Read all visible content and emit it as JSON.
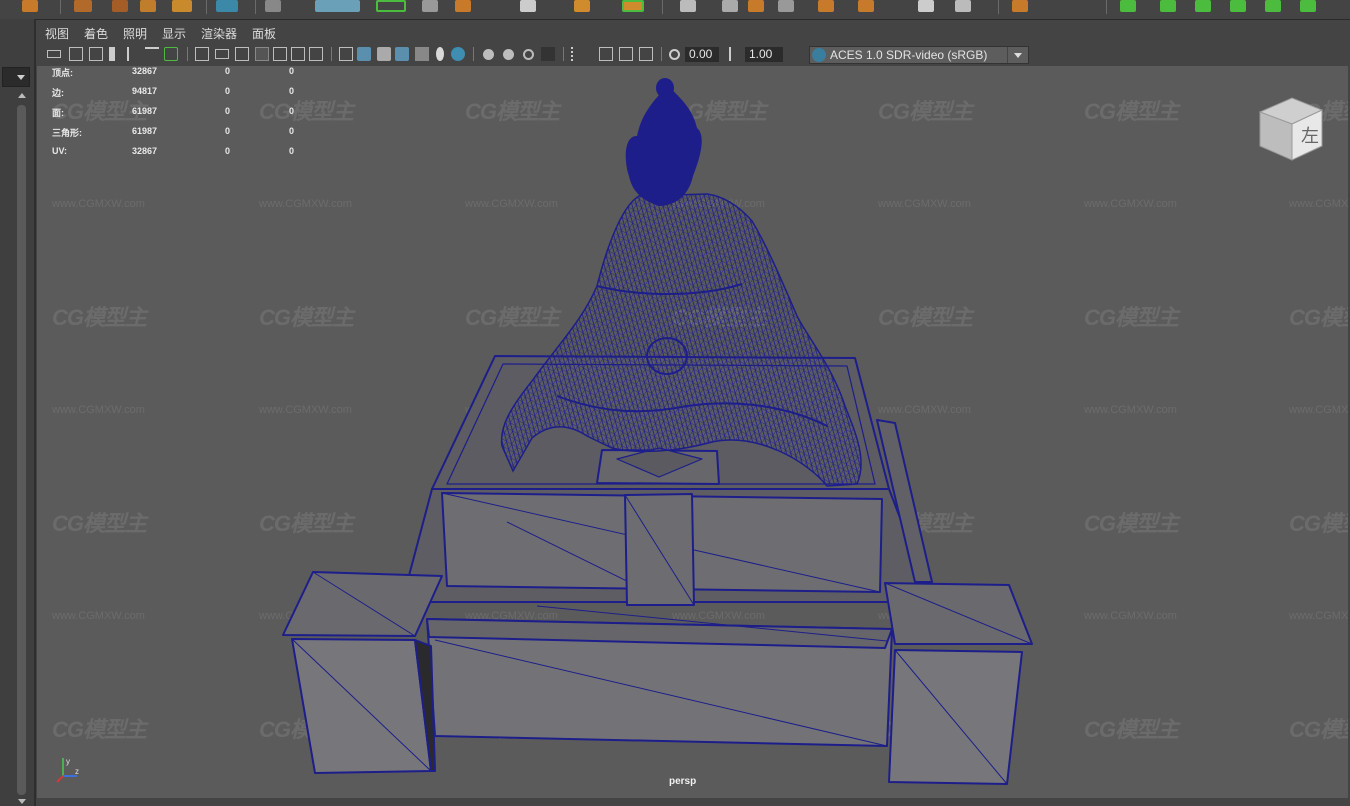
{
  "menu": [
    "视图",
    "着色",
    "照明",
    "显示",
    "渲染器",
    "面板"
  ],
  "toolbar": {
    "exposure_value": "0.00",
    "gamma_value": "1.00",
    "colorspace": "ACES 1.0 SDR-video (sRGB)"
  },
  "hud": [
    {
      "label": "顶点:",
      "v1": "32867",
      "v2": "0",
      "v3": "0"
    },
    {
      "label": "边:",
      "v1": "94817",
      "v2": "0",
      "v3": "0"
    },
    {
      "label": "面:",
      "v1": "61987",
      "v2": "0",
      "v3": "0"
    },
    {
      "label": "三角形:",
      "v1": "61987",
      "v2": "0",
      "v3": "0"
    },
    {
      "label": "UV:",
      "v1": "32867",
      "v2": "0",
      "v3": "0"
    }
  ],
  "watermark": {
    "logo": "CG模型主",
    "url": "www.CGMXW.com"
  },
  "camera_label": "persp",
  "viewcube_label": "左",
  "colors": {
    "wireframe": "#1d1e8a",
    "viewport_bg": "#5b5b5b",
    "ui_bg": "#444444",
    "accent": "#5a8fae"
  }
}
